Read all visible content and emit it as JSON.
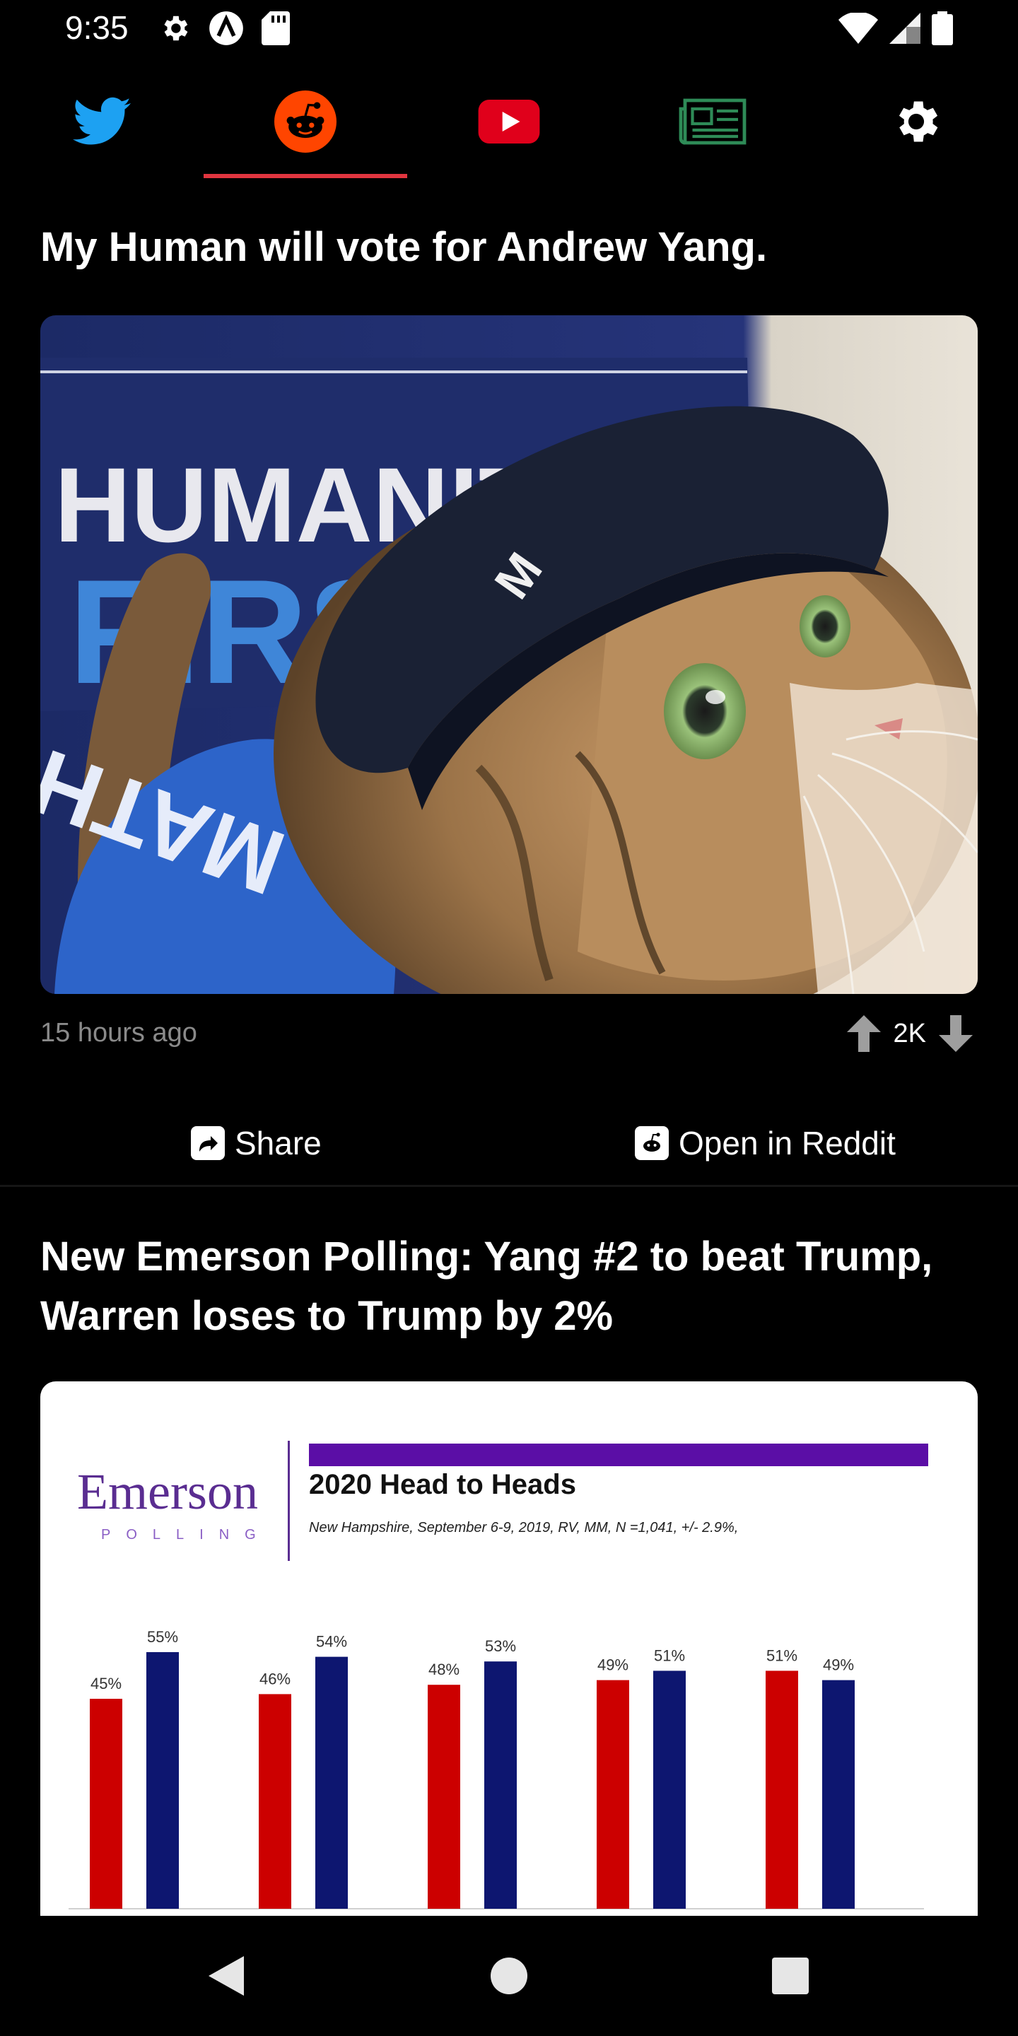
{
  "status_bar": {
    "time": "9:35",
    "icons": [
      "gear-icon",
      "app-a-icon",
      "sd-card-icon",
      "wifi-icon",
      "cell-signal-icon",
      "battery-icon"
    ]
  },
  "tabs": [
    {
      "name": "twitter",
      "icon": "twitter-bird-icon",
      "color": "#1da1f2",
      "selected": false
    },
    {
      "name": "reddit",
      "icon": "reddit-icon",
      "color": "#ff4500",
      "selected": true
    },
    {
      "name": "youtube",
      "icon": "youtube-play-icon",
      "color": "#e0001b",
      "selected": false
    },
    {
      "name": "news",
      "icon": "newspaper-icon",
      "color": "#2e8b57",
      "selected": false
    },
    {
      "name": "settings",
      "icon": "gear-icon",
      "color": "#ffffff",
      "selected": false
    }
  ],
  "posts": [
    {
      "title": "My Human will vote for Andrew Yang.",
      "image": {
        "sign_text_1": "HUMANITY",
        "sign_text_2": "FIRS",
        "shirt_text": "MATH",
        "cap_text": "M"
      },
      "time": "15 hours ago",
      "score": "2K",
      "share_label": "Share",
      "open_label": "Open in Reddit"
    },
    {
      "title": "New Emerson Polling: Yang #2 to beat Trump, Warren loses to Trump by 2%"
    }
  ],
  "chart": {
    "logo_word": "Emerson",
    "logo_sub": "POLLING",
    "accent_color": "#5b0ea6"
  },
  "chart_data": {
    "type": "bar",
    "title": "2020 Head to Heads",
    "subtitle": "New Hampshire, September 6-9, 2019, RV, MM, N =1,041,  +/- 2.9%,",
    "groups": 5,
    "series": [
      {
        "color": "#cc0000",
        "values": [
          45,
          46,
          48,
          49,
          51
        ]
      },
      {
        "color": "#0d1670",
        "values": [
          55,
          54,
          53,
          51,
          49
        ]
      }
    ],
    "data_labels": [
      [
        "45%",
        "55%"
      ],
      [
        "46%",
        "54%"
      ],
      [
        "48%",
        "53%"
      ],
      [
        "49%",
        "51%"
      ],
      [
        "51%",
        "49%"
      ]
    ]
  },
  "nav": {
    "icons": [
      "back-triangle-icon",
      "home-circle-icon",
      "recents-square-icon"
    ]
  }
}
